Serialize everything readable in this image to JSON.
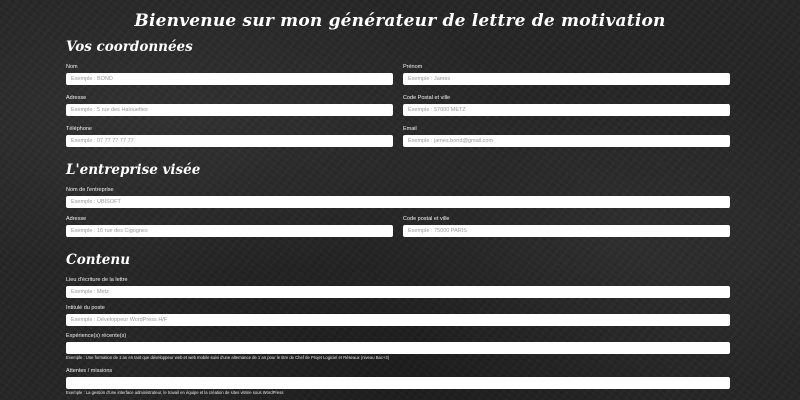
{
  "page": {
    "title": "Bienvenue sur mon générateur de lettre de motivation"
  },
  "sections": {
    "coordonnees": {
      "title": "Vos coordonnées",
      "nom": {
        "label": "Nom",
        "placeholder": "Exemple : BOND",
        "value": ""
      },
      "prenom": {
        "label": "Prénom",
        "placeholder": "Exemple : James",
        "value": ""
      },
      "adresse": {
        "label": "Adresse",
        "placeholder": "Exemple : 5 rue des Halouettes",
        "value": ""
      },
      "code_postal": {
        "label": "Code Postal et ville",
        "placeholder": "Exemple : 57000 METZ",
        "value": ""
      },
      "telephone": {
        "label": "Téléphone",
        "placeholder": "Exemple : 07 77 77 77 77",
        "value": ""
      },
      "email": {
        "label": "Email",
        "placeholder": "Exemple : james.bond@gmail.com",
        "value": ""
      }
    },
    "entreprise": {
      "title": "L'entreprise visée",
      "nom_entreprise": {
        "label": "Nom de l'entreprise",
        "placeholder": "Exemple : UBISOFT",
        "value": ""
      },
      "adresse": {
        "label": "Adresse",
        "placeholder": "Exemple : 16 rue des Cigognes",
        "value": ""
      },
      "code_postal": {
        "label": "Code postal et ville",
        "placeholder": "Exemple : 75000 PARIS",
        "value": ""
      }
    },
    "contenu": {
      "title": "Contenu",
      "lieu": {
        "label": "Lieu d'écriture de la lettre",
        "placeholder": "Exemple : Metz",
        "value": ""
      },
      "intitule": {
        "label": "Intitulé du poste",
        "placeholder": "Exemple : Développeur WordPress H/F",
        "value": ""
      },
      "experiences": {
        "label": "Expérience(s) récente(s)",
        "placeholder": "",
        "value": "",
        "help": "Exemple : Une formation de 1 an en tant que développeur web et web mobile suivi d'une alternance de 1 an pour le titre de Chef de Projet Logiciel et Réseaux (niveau Bac+3)"
      },
      "attentes": {
        "label": "Attentes / missions",
        "placeholder": "",
        "value": "",
        "help": "Exemple : La gestion d'une interface administrateur, le travail en équipe et la création de sites vitrine sous WordPress"
      }
    }
  }
}
